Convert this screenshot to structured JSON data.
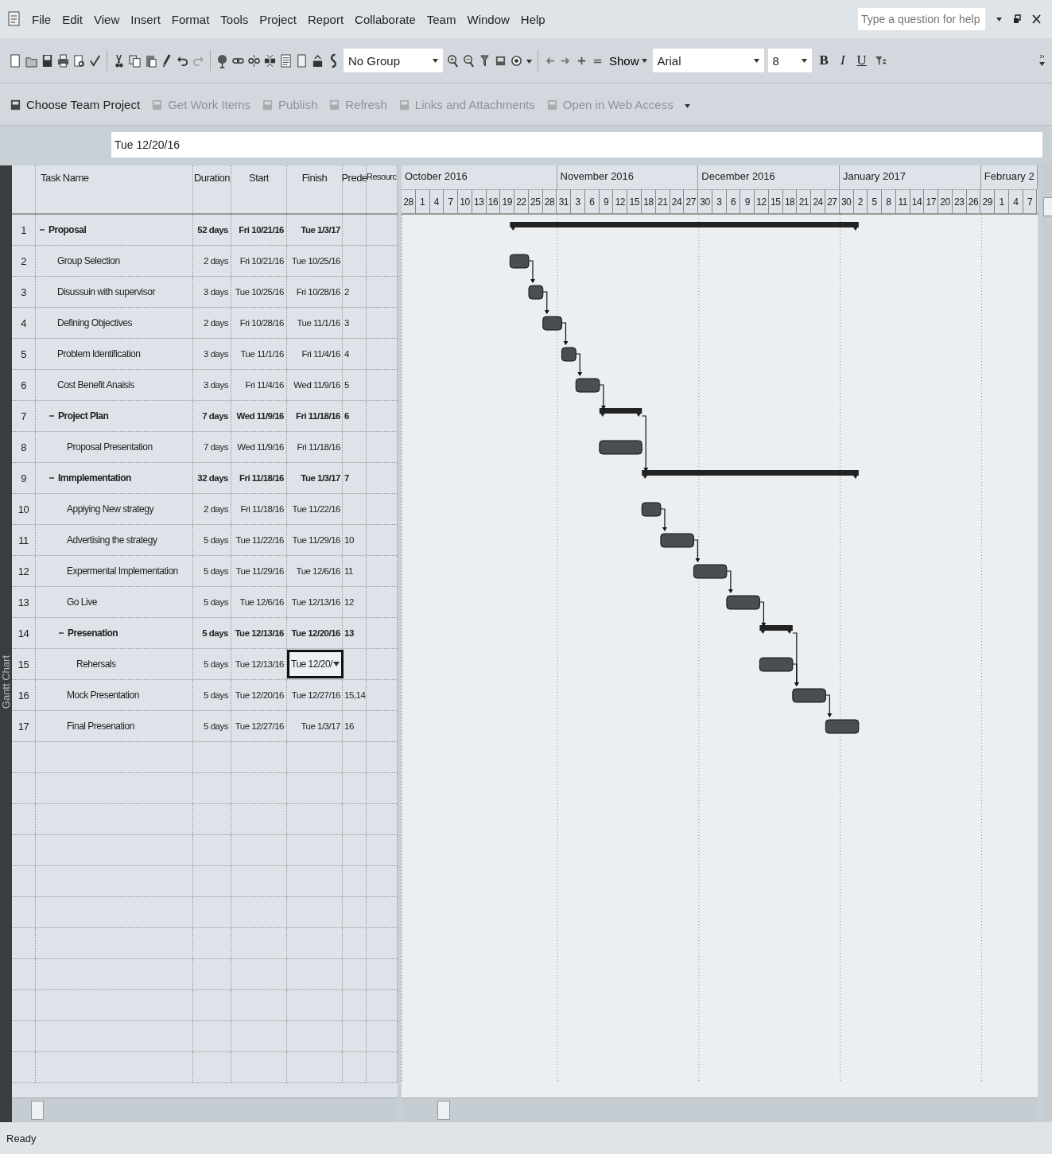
{
  "menu_bar": {
    "items": [
      "File",
      "Edit",
      "View",
      "Insert",
      "Format",
      "Tools",
      "Project",
      "Report",
      "Collaborate",
      "Team",
      "Window",
      "Help"
    ],
    "help_box": {
      "placeholder": "Type a question for help"
    }
  },
  "toolbar": {
    "group_select": {
      "value": "No Group"
    },
    "show_button": "Show",
    "font_select": {
      "value": "Arial"
    },
    "size_select": {
      "value": "8"
    },
    "format_buttons": [
      {
        "label": "B",
        "kind": "bold"
      },
      {
        "label": "I",
        "kind": "italic"
      },
      {
        "label": "U",
        "kind": "underline"
      }
    ]
  },
  "team_toolbar": {
    "items": [
      {
        "label": "Choose Team Project",
        "disabled": false
      },
      {
        "label": "Get Work Items",
        "disabled": true
      },
      {
        "label": "Publish",
        "disabled": true
      },
      {
        "label": "Refresh",
        "disabled": true
      },
      {
        "label": "Links and Attachments",
        "disabled": true
      },
      {
        "label": "Open in Web Access",
        "disabled": true
      }
    ]
  },
  "entry_bar": {
    "value": "Tue 12/20/16"
  },
  "view_bar": {
    "label": "Gantt Chart"
  },
  "table": {
    "columns": [
      "Task Name",
      "Duration",
      "Start",
      "Finish",
      "Prede",
      "Resourc"
    ],
    "tasks": [
      {
        "id": "1",
        "name": "Proposal",
        "duration": "52 days",
        "start": "Fri 10/21/16",
        "finish": "Tue 1/3/17",
        "editing": false,
        "expanded": true,
        "children": [
          {
            "id": "2",
            "name": "Group Selection",
            "duration": "2 days",
            "start": "Fri 10/21/16",
            "finish": "Tue 10/25/16",
            "editing": false
          },
          {
            "id": "3",
            "name": "Disussuin with supervisor",
            "duration": "3 days",
            "start": "Tue 10/25/16",
            "finish": "Fri 10/28/16",
            "predecessors": "2",
            "editing": false
          },
          {
            "id": "4",
            "name": "Defining Objectives",
            "duration": "2 days",
            "start": "Fri 10/28/16",
            "finish": "Tue 11/1/16",
            "predecessors": "3",
            "editing": false
          },
          {
            "id": "5",
            "name": "Problem Identification",
            "duration": "3 days",
            "start": "Tue 11/1/16",
            "finish": "Fri 11/4/16",
            "predecessors": "4",
            "editing": false
          },
          {
            "id": "6",
            "name": "Cost Benefit Anaisis",
            "duration": "3 days",
            "start": "Fri 11/4/16",
            "finish": "Wed 11/9/16",
            "predecessors": "5",
            "editing": false
          },
          {
            "id": "7",
            "name": "Project Plan",
            "duration": "7 days",
            "start": "Wed 11/9/16",
            "finish": "Fri 11/18/16",
            "predecessors": "6",
            "editing": false,
            "expanded": true,
            "children": [
              {
                "id": "8",
                "name": "Proposal Presentation",
                "duration": "7 days",
                "start": "Wed 11/9/16",
                "finish": "Fri 11/18/16",
                "editing": false
              }
            ]
          },
          {
            "id": "9",
            "name": "Immplementation",
            "duration": "32 days",
            "start": "Fri 11/18/16",
            "finish": "Tue 1/3/17",
            "predecessors": "7",
            "editing": false,
            "expanded": true,
            "children": [
              {
                "id": "10",
                "name": "Appiying New strategy",
                "duration": "2 days",
                "start": "Fri 11/18/16",
                "finish": "Tue 11/22/16",
                "editing": false
              },
              {
                "id": "11",
                "name": "Advertising the strategy",
                "duration": "5 days",
                "start": "Tue 11/22/16",
                "finish": "Tue 11/29/16",
                "predecessors": "10",
                "editing": false
              },
              {
                "id": "12",
                "name": "Expermental Implementation",
                "duration": "5 days",
                "start": "Tue 11/29/16",
                "finish": "Tue 12/6/16",
                "predecessors": "11",
                "editing": false
              },
              {
                "id": "13",
                "name": "Go Live",
                "duration": "5 days",
                "start": "Tue 12/6/16",
                "finish": "Tue 12/13/16",
                "predecessors": "12",
                "editing": false
              },
              {
                "id": "14",
                "name": "Presenation",
                "duration": "5 days",
                "start": "Tue 12/13/16",
                "finish": "Tue 12/20/16",
                "predecessors": "13",
                "editing": false,
                "expanded": true,
                "children": [
                  {
                    "id": "15",
                    "name": "Rehersals",
                    "duration": "5 days",
                    "start": "Tue 12/13/16",
                    "finish": "Tue 12/20/",
                    "editing": true
                  }
                ]
              },
              {
                "id": "16",
                "name": "Mock Presentation",
                "duration": "5 days",
                "start": "Tue 12/20/16",
                "finish": "Tue 12/27/16",
                "predecessors": "15,14",
                "editing": false
              },
              {
                "id": "17",
                "name": "Final Presenation",
                "duration": "5 days",
                "start": "Tue 12/27/16",
                "finish": "Tue 1/3/17",
                "predecessors": "16",
                "editing": false
              }
            ]
          }
        ]
      }
    ]
  },
  "timescale": {
    "months": [
      "October 2016",
      "November 2016",
      "December 2016",
      "January 2017",
      "February 2"
    ],
    "days": [
      "28",
      "1",
      "4",
      "7",
      "10",
      "13",
      "16",
      "19",
      "22",
      "25",
      "28",
      "31",
      "3",
      "6",
      "9",
      "12",
      "15",
      "18",
      "21",
      "24",
      "27",
      "30",
      "3",
      "6",
      "9",
      "12",
      "15",
      "18",
      "21",
      "24",
      "27",
      "30",
      "2",
      "5",
      "8",
      "11",
      "14",
      "17",
      "20",
      "23",
      "26",
      "29",
      "1",
      "4",
      "7"
    ]
  },
  "status_bar": {
    "text": "Ready"
  }
}
